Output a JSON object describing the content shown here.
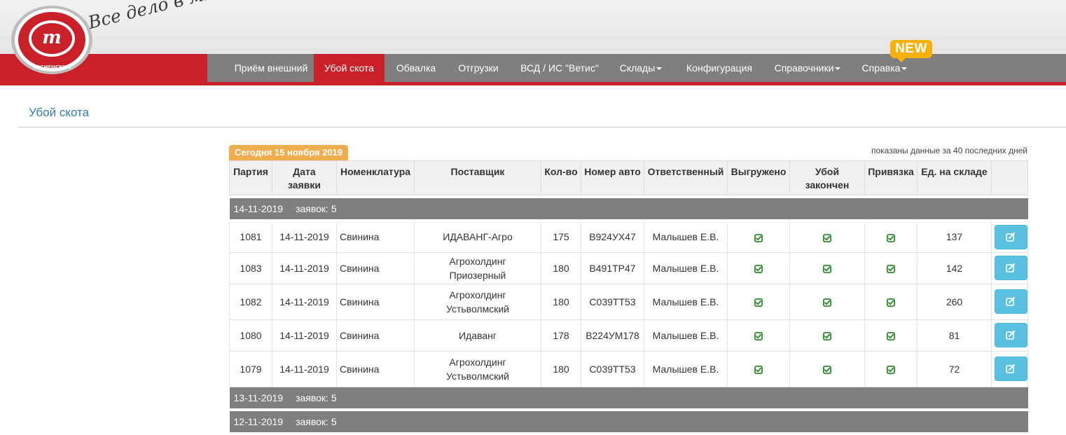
{
  "brand": {
    "logo_text": "ТОСНЕНСКИЙ МЯСОПЕРЕРАБАТЫВАЮЩИЙ КОМБИНАТ",
    "slogan": "Все дело в мясе...",
    "accent_red": "#c9202a",
    "nav_gray": "#7f7f7f"
  },
  "nav": {
    "items": [
      {
        "label": "Приём внешний"
      },
      {
        "label": "Убой скота",
        "active": true
      },
      {
        "label": "Обвалка"
      },
      {
        "label": "Отгрузки"
      },
      {
        "label": "ВСД / ИС \"Ветис\""
      },
      {
        "label": "Склады",
        "dropdown": true
      },
      {
        "label": "Конфигурация"
      },
      {
        "label": "Справочники",
        "dropdown": true
      },
      {
        "label": "Справка",
        "dropdown": true
      }
    ],
    "new_badge": "NEW"
  },
  "page": {
    "title": "Убой скота",
    "today_label": "Сегодня 15 ноября 2019",
    "shown_note": "показаны данные за 40 последних дней"
  },
  "table": {
    "headers": [
      "Партия",
      "Дата заявки",
      "Номенклатура",
      "Поставщик",
      "Кол-во",
      "Номер авто",
      "Ответственный",
      "Выгружено",
      "Убой закончен",
      "Привязка",
      "Ед. на складе",
      ""
    ],
    "groups": [
      {
        "date": "14-11-2019",
        "count_label": "заявок: 5",
        "rows": [
          {
            "party": "1081",
            "date": "14-11-2019",
            "nomenclature": "Свинина",
            "supplier": "ИДАВАНГ-Агро",
            "qty": "175",
            "car": "В924УХ47",
            "responsible": "Малышев Е.В.",
            "unloaded": true,
            "slaughter_done": true,
            "linked": true,
            "stock": "137"
          },
          {
            "party": "1083",
            "date": "14-11-2019",
            "nomenclature": "Свинина",
            "supplier": "Агрохолдинг Приозерный",
            "qty": "180",
            "car": "В491ТР47",
            "responsible": "Малышев Е.В.",
            "unloaded": true,
            "slaughter_done": true,
            "linked": true,
            "stock": "142"
          },
          {
            "party": "1082",
            "date": "14-11-2019",
            "nomenclature": "Свинина",
            "supplier": "Агрохолдинг Устьволмский",
            "qty": "180",
            "car": "С039ТТ53",
            "responsible": "Малышев Е.В.",
            "unloaded": true,
            "slaughter_done": true,
            "linked": true,
            "stock": "260"
          },
          {
            "party": "1080",
            "date": "14-11-2019",
            "nomenclature": "Свинина",
            "supplier": "Идаванг",
            "qty": "178",
            "car": "В224УМ178",
            "responsible": "Малышев Е.В.",
            "unloaded": true,
            "slaughter_done": true,
            "linked": true,
            "stock": "81"
          },
          {
            "party": "1079",
            "date": "14-11-2019",
            "nomenclature": "Свинина",
            "supplier": "Агрохолдинг Устьволмский",
            "qty": "180",
            "car": "С039ТТ53",
            "responsible": "Малышев Е.В.",
            "unloaded": true,
            "slaughter_done": true,
            "linked": true,
            "stock": "72"
          }
        ]
      },
      {
        "date": "13-11-2019",
        "count_label": "заявок: 5",
        "rows": []
      },
      {
        "date": "12-11-2019",
        "count_label": "заявок: 5",
        "rows": []
      }
    ]
  },
  "icons": {
    "check": "check-square-icon",
    "edit": "edit-icon"
  }
}
